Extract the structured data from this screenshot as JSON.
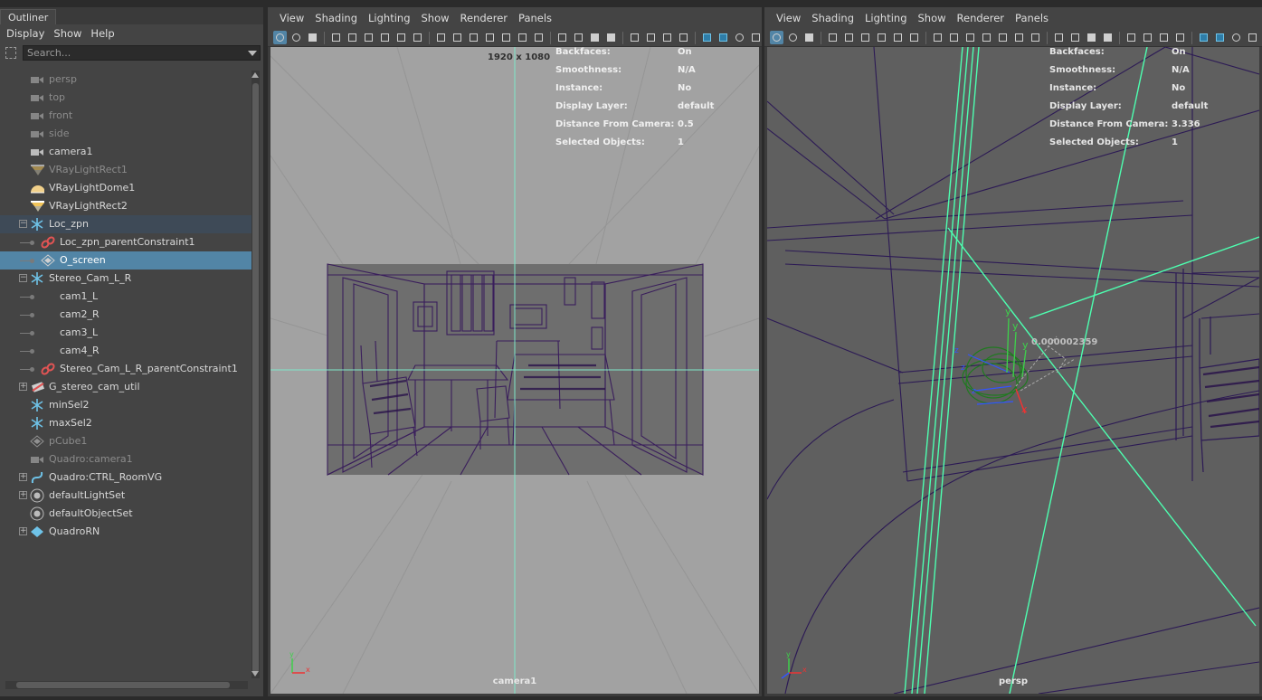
{
  "outliner": {
    "tab": "Outliner",
    "menu": [
      "Display",
      "Show",
      "Help"
    ],
    "search_placeholder": "Search...",
    "items": [
      {
        "label": "persp",
        "icon": "camera",
        "dim": true
      },
      {
        "label": "top",
        "icon": "camera",
        "dim": true
      },
      {
        "label": "front",
        "icon": "camera",
        "dim": true
      },
      {
        "label": "side",
        "icon": "camera",
        "dim": true
      },
      {
        "label": "camera1",
        "icon": "camera",
        "dim": false
      },
      {
        "label": "VRayLightRect1",
        "icon": "rect-light",
        "dim": true
      },
      {
        "label": "VRayLightDome1",
        "icon": "dome-light",
        "dim": false
      },
      {
        "label": "VRayLightRect2",
        "icon": "rect-light",
        "dim": false
      },
      {
        "label": "Loc_zpn",
        "icon": "locator",
        "dim": false
      },
      {
        "label": "Loc_zpn_parentConstraint1",
        "icon": "constraint",
        "dim": false
      },
      {
        "label": "O_screen",
        "icon": "mesh",
        "dim": false
      },
      {
        "label": "Stereo_Cam_L_R",
        "icon": "locator",
        "dim": false
      },
      {
        "label": "cam1_L",
        "icon": "none",
        "dim": false
      },
      {
        "label": "cam2_R",
        "icon": "none",
        "dim": false
      },
      {
        "label": "cam3_L",
        "icon": "none",
        "dim": false
      },
      {
        "label": "cam4_R",
        "icon": "none",
        "dim": false
      },
      {
        "label": "Stereo_Cam_L_R_parentConstraint1",
        "icon": "constraint",
        "dim": false
      },
      {
        "label": "G_stereo_cam_util",
        "icon": "group",
        "dim": false
      },
      {
        "label": "minSel2",
        "icon": "locator",
        "dim": false
      },
      {
        "label": "maxSel2",
        "icon": "locator",
        "dim": false
      },
      {
        "label": "pCube1",
        "icon": "mesh",
        "dim": true
      },
      {
        "label": "Quadro:camera1",
        "icon": "camera",
        "dim": true
      },
      {
        "label": "Quadro:CTRL_RoomVG",
        "icon": "curve",
        "dim": false
      },
      {
        "label": "defaultLightSet",
        "icon": "set",
        "dim": false
      },
      {
        "label": "defaultObjectSet",
        "icon": "set",
        "dim": false
      },
      {
        "label": "QuadroRN",
        "icon": "reference",
        "dim": false
      }
    ]
  },
  "viewport_menu": [
    "View",
    "Shading",
    "Lighting",
    "Show",
    "Renderer",
    "Panels"
  ],
  "hud_keys": [
    "Backfaces:",
    "Smoothness:",
    "Instance:",
    "Display Layer:",
    "Distance From Camera:",
    "Selected Objects:"
  ],
  "viewport1": {
    "camera": "camera1",
    "resolution": "1920 x 1080",
    "hud_values": [
      "On",
      "N/A",
      "No",
      "default",
      "0.5",
      "1"
    ]
  },
  "viewport2": {
    "camera": "persp",
    "hud_values": [
      "On",
      "N/A",
      "No",
      "default",
      "3.336",
      "1"
    ],
    "annotation": "0.000002359"
  },
  "colors": {
    "selection": "#5285a6",
    "wire": "#3a1e5c",
    "constraint": "#4dffb0"
  }
}
